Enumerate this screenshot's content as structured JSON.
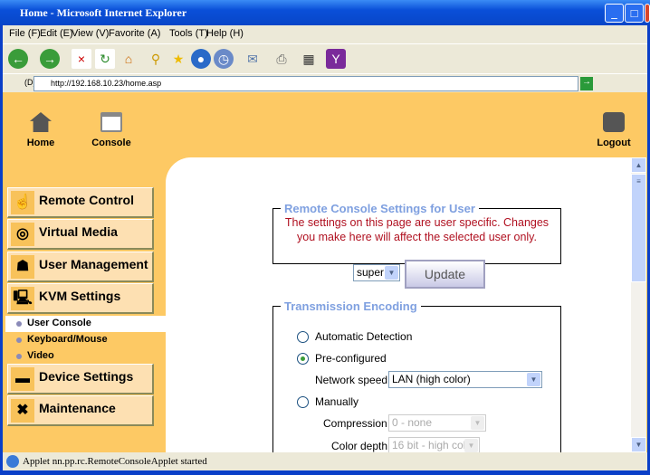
{
  "window": {
    "title": "Home - Microsoft Internet Explorer"
  },
  "menu": [
    "File (F)",
    "Edit (E)",
    "View (V)",
    "Favorite (A)",
    "Tools (T)",
    "Help (H)"
  ],
  "address": {
    "label": "(D)",
    "url": "http://192.168.10.23/home.asp"
  },
  "header": {
    "home": "Home",
    "console": "Console",
    "logout": "Logout"
  },
  "sidebar": {
    "items": [
      "Remote Control",
      "Virtual Media",
      "User Management",
      "KVM Settings",
      "Device Settings",
      "Maintenance"
    ],
    "subitems": [
      "User Console",
      "Keyboard/Mouse",
      "Video"
    ]
  },
  "settings": {
    "legend": "Remote Console Settings for User",
    "note": "The settings on this page are user specific. Changes you make here will affect the selected user only.",
    "user": "super",
    "update": "Update"
  },
  "encoding": {
    "legend": "Transmission Encoding",
    "auto": "Automatic Detection",
    "preconf": "Pre-configured",
    "speed_label": "Network speed",
    "speed": "LAN (high color)",
    "manual": "Manually",
    "compression_label": "Compression",
    "compression": "0 - none",
    "depth_label": "Color depth",
    "depth": "16 bit - high col"
  },
  "status": "Applet nn.pp.rc.RemoteConsoleApplet started"
}
